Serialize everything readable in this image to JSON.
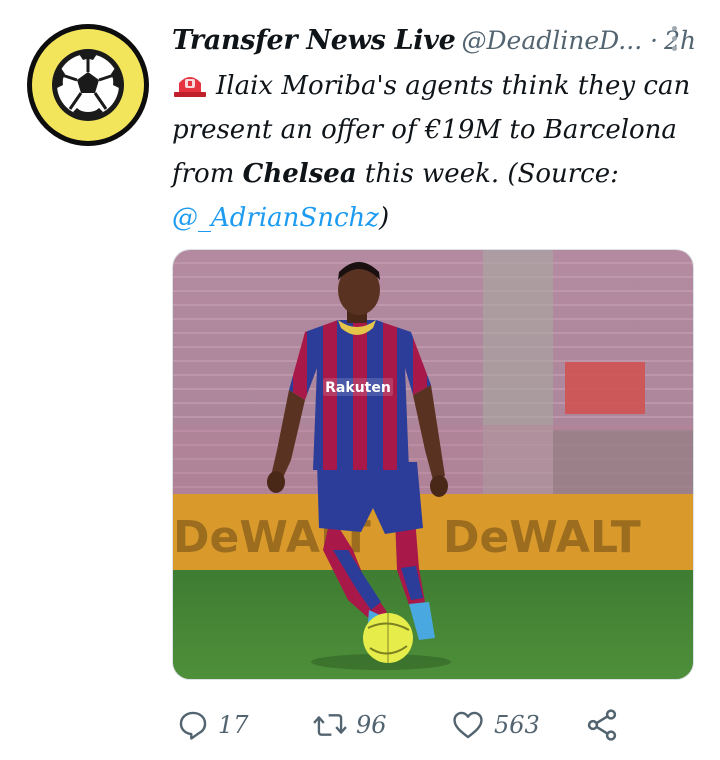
{
  "tweet": {
    "display_name": "Transfer News Live",
    "handle": "@DeadlineD...",
    "separator": "·",
    "time": "2h",
    "text_part1": "Ilaix Moriba's agents think they can present an offer of €19M to Barcelona from ",
    "text_bold": "Chelsea",
    "text_part2": " this week. (Source: ",
    "mention": "@_AdrianSnchz",
    "text_part3": ")"
  },
  "media": {
    "shirt_sponsor": "Rakuten",
    "board_text_left": "DeWALT",
    "board_text_right": "DeWALT"
  },
  "actions": {
    "replies": "17",
    "retweets": "96",
    "likes": "563"
  },
  "colors": {
    "accent": "#1d9bf0",
    "avatar_ring": "#f3e55b",
    "muted": "#536471"
  },
  "icons": {
    "siren": "police-light-emoji",
    "reply": "reply-icon",
    "retweet": "retweet-icon",
    "like": "heart-icon",
    "share": "share-icon",
    "more": "more-icon"
  }
}
